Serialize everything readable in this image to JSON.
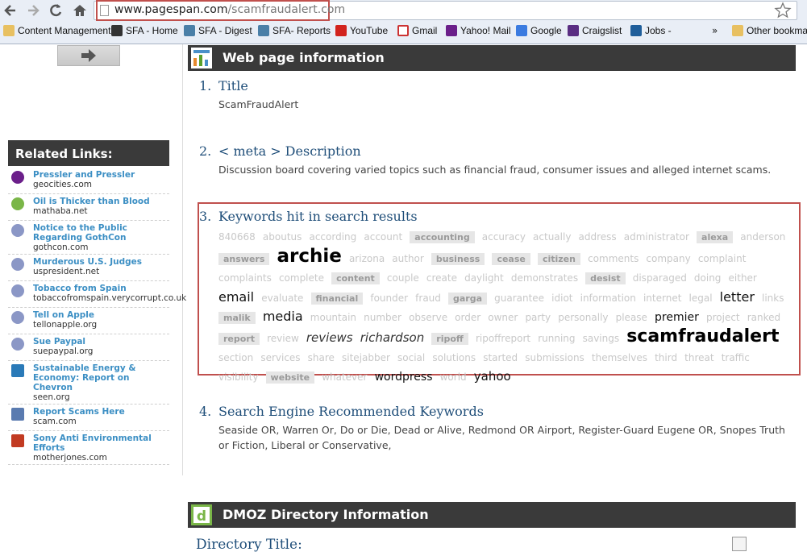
{
  "browser": {
    "url_host": "www.pagespan.com",
    "url_path": "/scamfraudalert.com",
    "bookmarks": [
      {
        "label": "Content Management",
        "icon": "folder-icon"
      },
      {
        "label": "SFA - Home",
        "icon": "sfa-icon"
      },
      {
        "label": "SFA - Digest",
        "icon": "wordpress-icon"
      },
      {
        "label": "SFA- Reports",
        "icon": "wordpress-icon"
      },
      {
        "label": "YouTube",
        "icon": "youtube-icon"
      },
      {
        "label": "Gmail",
        "icon": "gmail-icon"
      },
      {
        "label": "Yahoo! Mail",
        "icon": "yahoo-icon"
      },
      {
        "label": "Google",
        "icon": "google-icon"
      },
      {
        "label": "Craigslist",
        "icon": "peace-icon"
      },
      {
        "label": "Jobs -",
        "icon": "jobs-icon"
      }
    ],
    "overflow": "»",
    "other_bookmarks": "Other bookmarks"
  },
  "sidebar": {
    "related_heading": "Related Links:",
    "links": [
      {
        "title": "Pressler and Pressler",
        "domain": "geocities.com",
        "icon": "yahoo-icon"
      },
      {
        "title": "Oil is Thicker than Blood",
        "domain": "mathaba.net",
        "icon": "green-c-icon"
      },
      {
        "title": "Notice to the Public Regarding GothCon",
        "domain": "gothcon.com",
        "icon": "globe-icon"
      },
      {
        "title": "Murderous U.S. Judges",
        "domain": "uspresident.net",
        "icon": "globe-icon"
      },
      {
        "title": "Tobacco from Spain",
        "domain": "tobaccofromspain.verycorrupt.co.uk",
        "icon": "globe-icon"
      },
      {
        "title": "Tell on Apple",
        "domain": "tellonapple.org",
        "icon": "globe-icon"
      },
      {
        "title": "Sue Paypal",
        "domain": "suepaypal.org",
        "icon": "globe-icon"
      },
      {
        "title": "Sustainable Energy & Economy: Report on Chevron",
        "domain": "seen.org",
        "icon": "seen-icon"
      },
      {
        "title": "Report Scams Here",
        "domain": "scam.com",
        "icon": "scam-icon"
      },
      {
        "title": "Sony Anti Environmental Efforts",
        "domain": "motherjones.com",
        "icon": "mj-icon"
      }
    ]
  },
  "main": {
    "webinfo_heading": "Web page information",
    "items": [
      {
        "num": "1.",
        "title": "Title",
        "text": "ScamFraudAlert"
      },
      {
        "num": "2.",
        "title": "< meta > Description",
        "text": "Discussion board covering varied topics such as financial fraud, consumer issues and alleged internet scams."
      },
      {
        "num": "3.",
        "title": "Keywords hit in search results"
      },
      {
        "num": "4.",
        "title": "Search Engine Recommended Keywords",
        "text": "Seaside OR, Warren Or, Do or Die, Dead or Alive, Redmond OR Airport, Register-Guard Eugene OR, Snopes Truth or Fiction, Liberal or Conservative,"
      }
    ],
    "keywords": [
      {
        "w": "840668",
        "s": "t1"
      },
      {
        "w": "aboutus",
        "s": "t1"
      },
      {
        "w": "according",
        "s": "t1"
      },
      {
        "w": "account",
        "s": "t1"
      },
      {
        "w": "accounting",
        "s": "tb"
      },
      {
        "w": "accuracy",
        "s": "t1"
      },
      {
        "w": "actually",
        "s": "t1"
      },
      {
        "w": "address",
        "s": "t1"
      },
      {
        "w": "administrator",
        "s": "t1"
      },
      {
        "w": "alexa",
        "s": "tb"
      },
      {
        "w": "anderson",
        "s": "t1"
      },
      {
        "w": "answers",
        "s": "tb"
      },
      {
        "w": "archie",
        "s": "t-archie"
      },
      {
        "w": "arizona",
        "s": "t1"
      },
      {
        "w": "author",
        "s": "t1"
      },
      {
        "w": "business",
        "s": "tb"
      },
      {
        "w": "cease",
        "s": "tb"
      },
      {
        "w": "citizen",
        "s": "tb"
      },
      {
        "w": "comments",
        "s": "t1"
      },
      {
        "w": "company",
        "s": "t1"
      },
      {
        "w": "complaint",
        "s": "t1"
      },
      {
        "w": "complaints",
        "s": "t1"
      },
      {
        "w": "complete",
        "s": "t1"
      },
      {
        "w": "content",
        "s": "tb"
      },
      {
        "w": "couple",
        "s": "t1"
      },
      {
        "w": "create",
        "s": "t1"
      },
      {
        "w": "daylight",
        "s": "t1"
      },
      {
        "w": "demonstrates",
        "s": "t1"
      },
      {
        "w": "desist",
        "s": "tb"
      },
      {
        "w": "disparaged",
        "s": "t1"
      },
      {
        "w": "doing",
        "s": "t1"
      },
      {
        "w": "either",
        "s": "t1"
      },
      {
        "w": "email",
        "s": "t-email"
      },
      {
        "w": "evaluate",
        "s": "t1"
      },
      {
        "w": "financial",
        "s": "tb"
      },
      {
        "w": "founder",
        "s": "t1"
      },
      {
        "w": "fraud",
        "s": "t1"
      },
      {
        "w": "garga",
        "s": "tb"
      },
      {
        "w": "guarantee",
        "s": "t1"
      },
      {
        "w": "idiot",
        "s": "t1"
      },
      {
        "w": "information",
        "s": "t1"
      },
      {
        "w": "internet",
        "s": "t1"
      },
      {
        "w": "legal",
        "s": "t1"
      },
      {
        "w": "letter",
        "s": "t-letter"
      },
      {
        "w": "links",
        "s": "t1"
      },
      {
        "w": "malik",
        "s": "tb"
      },
      {
        "w": "media",
        "s": "t-media"
      },
      {
        "w": "mountain",
        "s": "t1"
      },
      {
        "w": "number",
        "s": "t1"
      },
      {
        "w": "observe",
        "s": "t1"
      },
      {
        "w": "order",
        "s": "t1"
      },
      {
        "w": "owner",
        "s": "t1"
      },
      {
        "w": "party",
        "s": "t1"
      },
      {
        "w": "personally",
        "s": "t1"
      },
      {
        "w": "please",
        "s": "t1"
      },
      {
        "w": "premier",
        "s": "t-premier"
      },
      {
        "w": "project",
        "s": "t1"
      },
      {
        "w": "ranked",
        "s": "t1"
      },
      {
        "w": "report",
        "s": "tb"
      },
      {
        "w": "review",
        "s": "t1"
      },
      {
        "w": "reviews",
        "s": "t-reviews"
      },
      {
        "w": "richardson",
        "s": "t-reviews"
      },
      {
        "w": "ripoff",
        "s": "tb"
      },
      {
        "w": "ripoffreport",
        "s": "t1"
      },
      {
        "w": "running",
        "s": "t1"
      },
      {
        "w": "savings",
        "s": "t1"
      },
      {
        "w": "scamfraudalert",
        "s": "t-scam"
      },
      {
        "w": "section",
        "s": "t1"
      },
      {
        "w": "services",
        "s": "t1"
      },
      {
        "w": "share",
        "s": "t1"
      },
      {
        "w": "sitejabber",
        "s": "t1"
      },
      {
        "w": "social",
        "s": "t1"
      },
      {
        "w": "solutions",
        "s": "t1"
      },
      {
        "w": "started",
        "s": "t1"
      },
      {
        "w": "submissions",
        "s": "t1"
      },
      {
        "w": "themselves",
        "s": "t1"
      },
      {
        "w": "third",
        "s": "t1"
      },
      {
        "w": "threat",
        "s": "t1"
      },
      {
        "w": "traffic",
        "s": "t1"
      },
      {
        "w": "visibility",
        "s": "t1"
      },
      {
        "w": "website",
        "s": "tb"
      },
      {
        "w": "whatever",
        "s": "t1"
      },
      {
        "w": "wordpress",
        "s": "t-wordpress"
      },
      {
        "w": "world",
        "s": "t1"
      },
      {
        "w": "yahoo",
        "s": "t-yahoo"
      }
    ],
    "dmoz_heading": "DMOZ Directory Information",
    "directory_title": "Directory Title:"
  }
}
